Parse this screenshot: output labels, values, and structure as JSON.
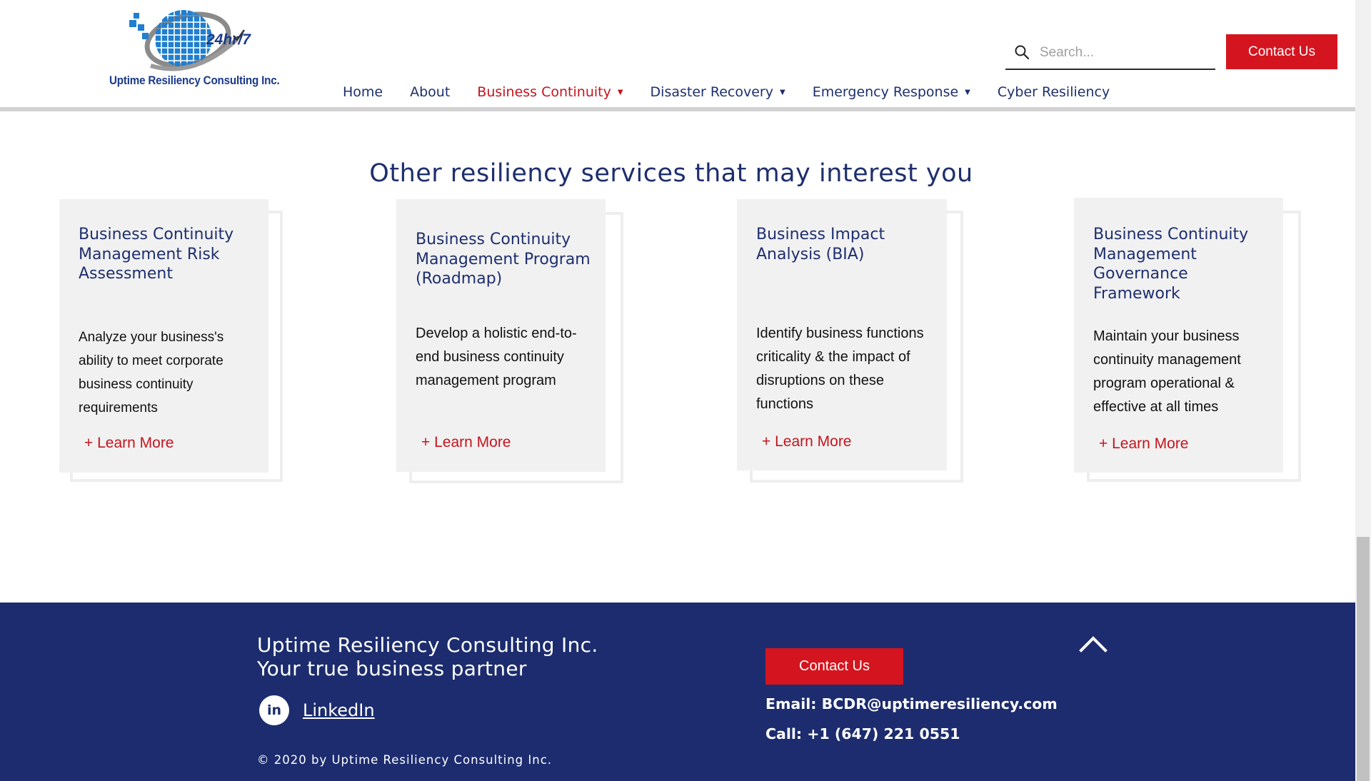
{
  "header": {
    "logo_text": "Uptime  Resiliency Consulting Inc.",
    "logo_badge": "24hr/7",
    "search_placeholder": "Search...",
    "contact_label": "Contact Us",
    "nav": [
      {
        "label": "Home",
        "has_dropdown": false,
        "active": false
      },
      {
        "label": "About",
        "has_dropdown": false,
        "active": false
      },
      {
        "label": "Business Continuity",
        "has_dropdown": true,
        "active": true
      },
      {
        "label": "Disaster Recovery",
        "has_dropdown": true,
        "active": false
      },
      {
        "label": "Emergency Response",
        "has_dropdown": true,
        "active": false
      },
      {
        "label": "Cyber Resiliency",
        "has_dropdown": false,
        "active": false
      }
    ]
  },
  "section": {
    "title": "Other resiliency services that may interest you",
    "cards": [
      {
        "title": "Business Continuity Management Risk Assessment",
        "description": "Analyze your business's ability to meet corporate business continuity requirements",
        "link": "+ Learn More"
      },
      {
        "title": "Business Continuity Management Program (Roadmap)",
        "description": "Develop a holistic end-to-end business continuity management program",
        "link": "+ Learn More"
      },
      {
        "title": "Business Impact Analysis (BIA)",
        "description": "Identify business functions criticality & the impact of disruptions on these functions",
        "link": "+ Learn More"
      },
      {
        "title": "Business Continuity Management Governance Framework",
        "description": "Maintain your business continuity management program operational & effective at all times",
        "link": "+ Learn More"
      }
    ]
  },
  "footer": {
    "company": "Uptime Resiliency Consulting Inc.",
    "tagline": "Your true business partner",
    "linkedin_icon_text": "in",
    "linkedin_label": "LinkedIn",
    "copyright": "© 2020 by Uptime Resiliency Consulting Inc.",
    "contact_label": "Contact Us",
    "email": "Email: BCDR@uptimeresiliency.com",
    "call": "Call: +1 (647) 221 0551"
  },
  "colors": {
    "accent_red": "#d4151f",
    "navy": "#1c2c6e",
    "card_bg": "#f1f1f1"
  },
  "icons": {
    "search": "search-icon",
    "linkedin": "linkedin-icon",
    "back_to_top": "chevron-up-icon",
    "dropdown": "caret-down-icon"
  }
}
